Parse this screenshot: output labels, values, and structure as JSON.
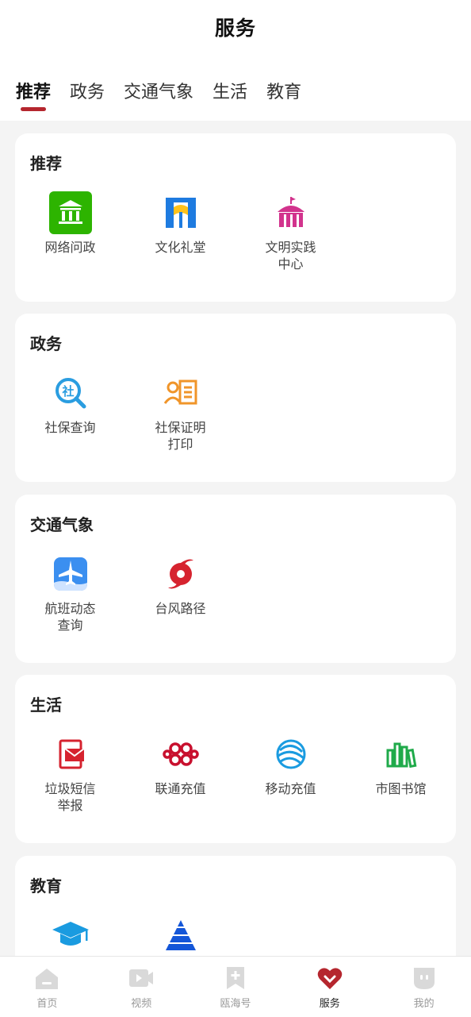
{
  "header": {
    "title": "服务"
  },
  "tabs": [
    {
      "label": "推荐",
      "active": true
    },
    {
      "label": "政务",
      "active": false
    },
    {
      "label": "交通气象",
      "active": false
    },
    {
      "label": "生活",
      "active": false
    },
    {
      "label": "教育",
      "active": false
    }
  ],
  "sections": [
    {
      "title": "推荐",
      "items": [
        {
          "label": "网络问政",
          "icon": "government-building-icon"
        },
        {
          "label": "文化礼堂",
          "icon": "culture-hall-icon"
        },
        {
          "label": "文明实践中心",
          "icon": "civilization-tent-icon"
        }
      ]
    },
    {
      "title": "政务",
      "items": [
        {
          "label": "社保查询",
          "icon": "social-security-search-icon"
        },
        {
          "label": "社保证明打印",
          "icon": "certificate-print-icon"
        }
      ]
    },
    {
      "title": "交通气象",
      "items": [
        {
          "label": "航班动态查询",
          "icon": "airplane-icon"
        },
        {
          "label": "台风路径",
          "icon": "typhoon-icon"
        }
      ]
    },
    {
      "title": "生活",
      "items": [
        {
          "label": "垃圾短信举报",
          "icon": "spam-sms-report-icon"
        },
        {
          "label": "联通充值",
          "icon": "china-unicom-icon"
        },
        {
          "label": "移动充值",
          "icon": "china-mobile-icon"
        },
        {
          "label": "市图书馆",
          "icon": "library-books-icon"
        }
      ]
    },
    {
      "title": "教育",
      "items": [
        {
          "label": "",
          "icon": "graduation-cap-icon"
        },
        {
          "label": "",
          "icon": "pyramid-icon"
        }
      ]
    }
  ],
  "bottom_nav": [
    {
      "label": "首页",
      "icon": "home-icon",
      "active": false
    },
    {
      "label": "视频",
      "icon": "video-icon",
      "active": false
    },
    {
      "label": "瓯海号",
      "icon": "bookmark-plus-icon",
      "active": false
    },
    {
      "label": "服务",
      "icon": "heart-icon",
      "active": true
    },
    {
      "label": "我的",
      "icon": "profile-face-icon",
      "active": false
    }
  ],
  "colors": {
    "accent": "#b5262e",
    "green": "#2db400",
    "blue": "#1e7be0",
    "magenta": "#d2338d",
    "orange": "#f0952a",
    "red": "#d6232f"
  }
}
